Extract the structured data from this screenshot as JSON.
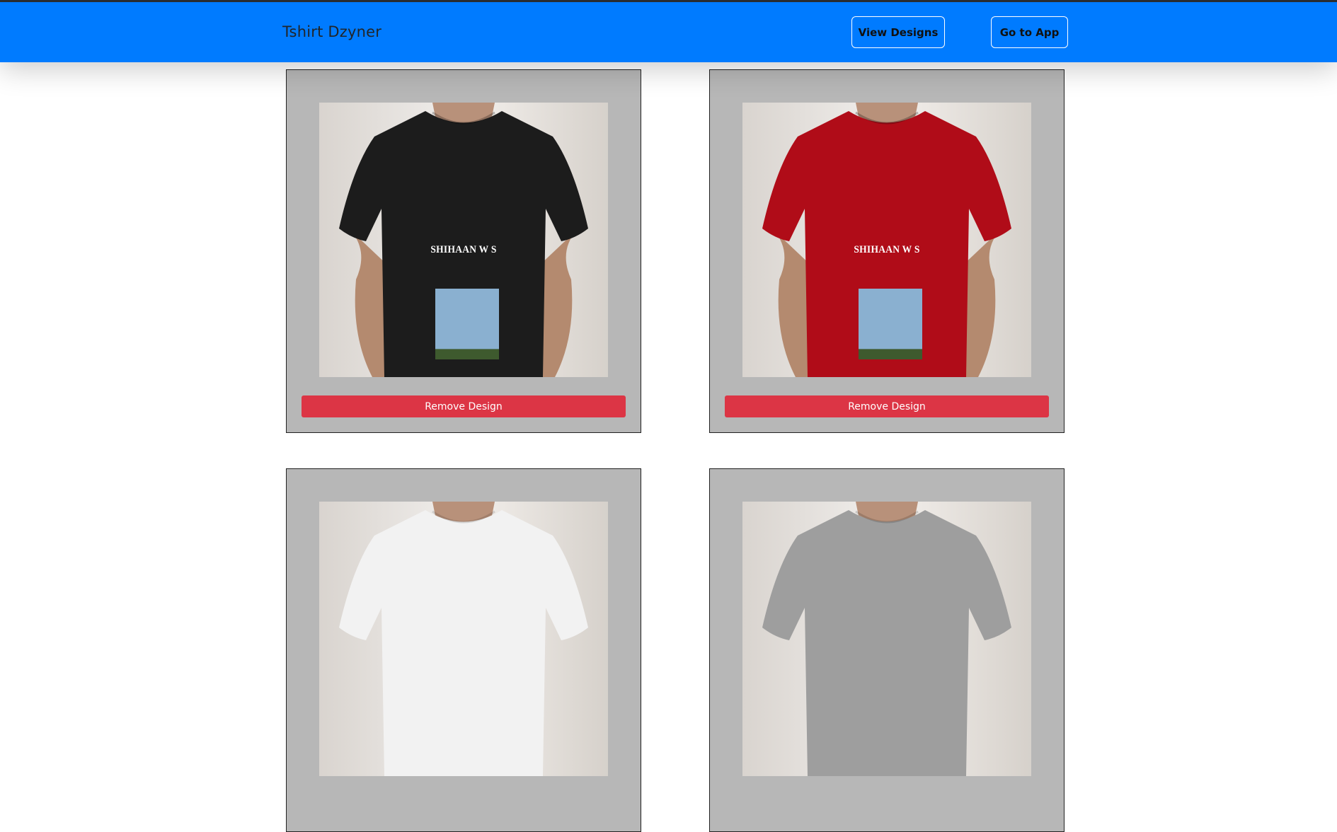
{
  "navbar": {
    "brand": "Tshirt Dzyner",
    "view_designs_label": "View Designs",
    "go_to_app_label": "Go to App",
    "background_color": "#007bff"
  },
  "designs": [
    {
      "shirt_color": "#1c1c1c",
      "text": "SHIHAAN W S",
      "has_photo": true,
      "remove_label": "Remove Design"
    },
    {
      "shirt_color": "#b00c18",
      "text": "SHIHAAN W S",
      "has_photo": true,
      "remove_label": "Remove Design"
    },
    {
      "shirt_color": "#f2f2f2"
    },
    {
      "shirt_color": "#9e9e9e"
    }
  ],
  "colors": {
    "card_background": "#b7b7b7",
    "remove_button": "#dc3545"
  }
}
